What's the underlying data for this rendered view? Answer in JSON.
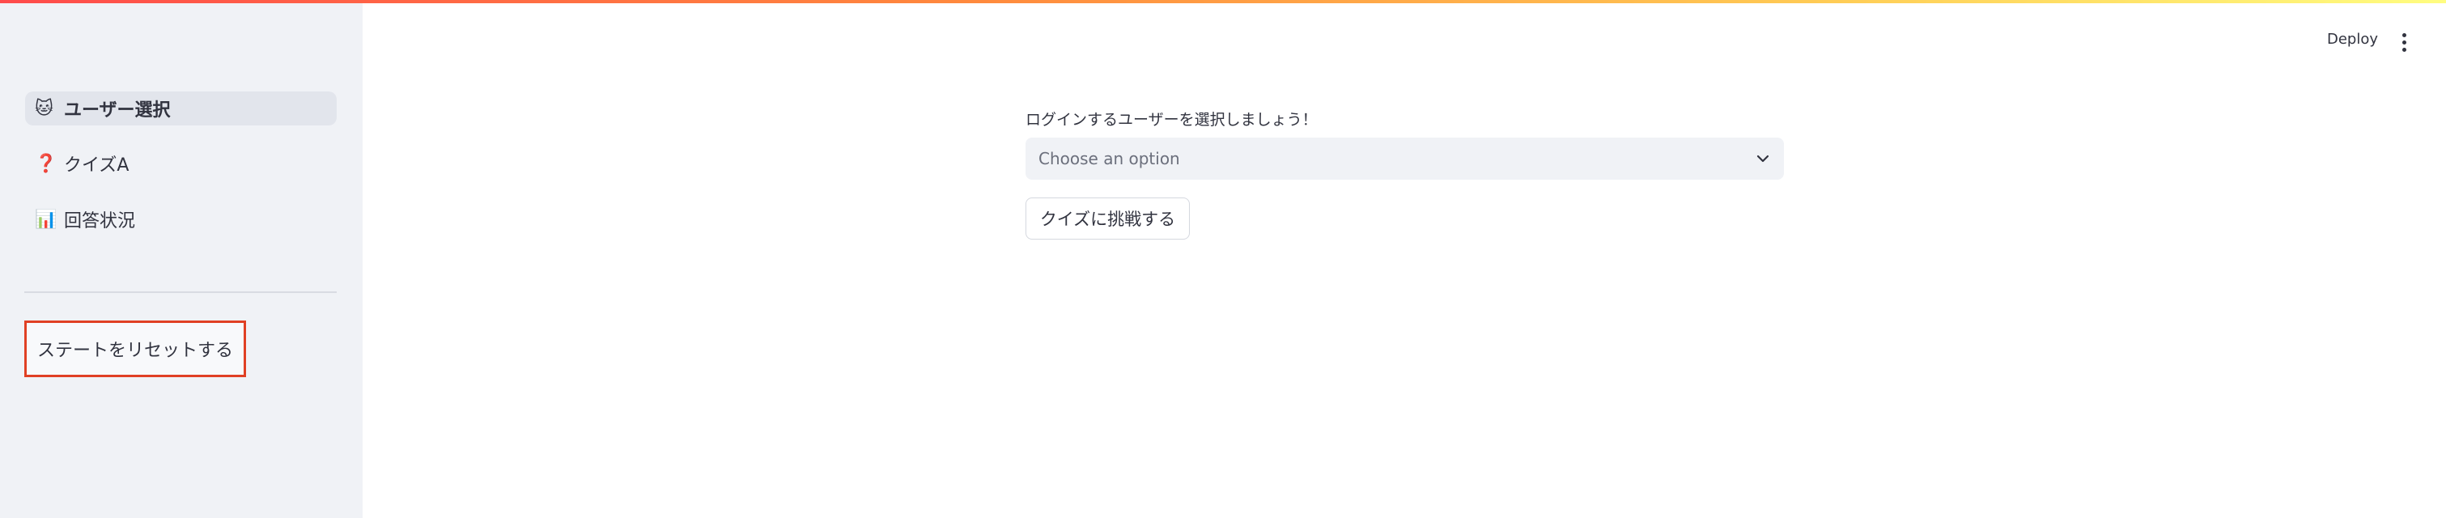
{
  "sidebar": {
    "items": [
      {
        "icon": "🐱",
        "icon_name": "cat-face-icon",
        "label": "ユーザー選択",
        "active": true
      },
      {
        "icon": "❓",
        "icon_name": "question-mark-icon",
        "label": "クイズA",
        "active": false
      },
      {
        "icon": "📊",
        "icon_name": "bar-chart-icon",
        "label": "回答状況",
        "active": false
      }
    ],
    "reset_button_label": "ステートをリセットする"
  },
  "header": {
    "deploy_label": "Deploy",
    "menu_icon": "vertical-ellipsis-icon"
  },
  "main": {
    "prompt": "ログインするユーザーを選択しましょう！",
    "select": {
      "placeholder": "Choose an option",
      "icon": "chevron-down-icon"
    },
    "quiz_button_label": "クイズに挑戦する"
  },
  "colors": {
    "sidebar_bg": "#f0f2f6",
    "highlight_border": "#e04024",
    "text": "#31333f",
    "decoration_start": "#ff4b4b",
    "decoration_end": "#fffd80"
  }
}
